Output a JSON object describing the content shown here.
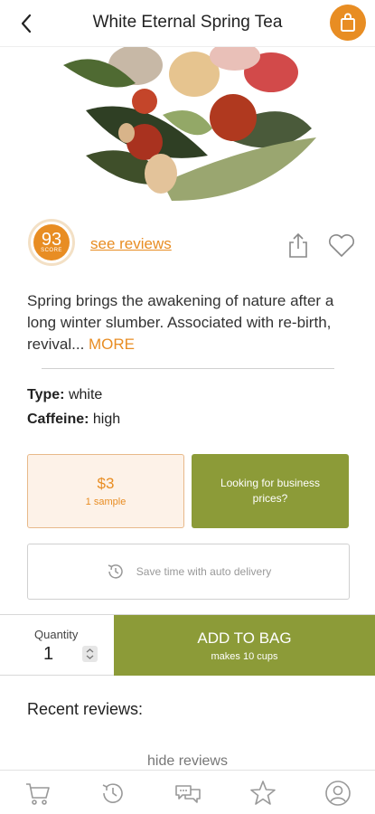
{
  "header": {
    "title": "White Eternal Spring Tea",
    "back_icon": "chevron-left-icon",
    "bag_icon": "shopping-bag-icon"
  },
  "product": {
    "score": "93",
    "score_label": "SCORE",
    "see_reviews": "see reviews",
    "description": "Spring brings the awakening of nature after a long winter slumber. Associated with re-birth, revival...",
    "more": " MORE",
    "type_label": "Type:",
    "type_value": "white",
    "caffeine_label": "Caffeine:",
    "caffeine_value": "high"
  },
  "sample": {
    "price": "$3",
    "label": "1 sample"
  },
  "business": {
    "label": "Looking for business prices?"
  },
  "auto_delivery": {
    "label": "Save time with auto delivery"
  },
  "purchase": {
    "quantity_label": "Quantity",
    "quantity_value": "1",
    "add_label": "ADD TO BAG",
    "add_sub": "makes 10 cups"
  },
  "reviews": {
    "heading": "Recent reviews:",
    "hide": "hide reviews"
  },
  "nav": {
    "items": [
      "cart-icon",
      "history-icon",
      "chat-icon",
      "star-icon",
      "account-icon"
    ]
  },
  "colors": {
    "accent": "#e88d23",
    "olive": "#8c9b38",
    "sample_bg": "#fdf2e8"
  }
}
